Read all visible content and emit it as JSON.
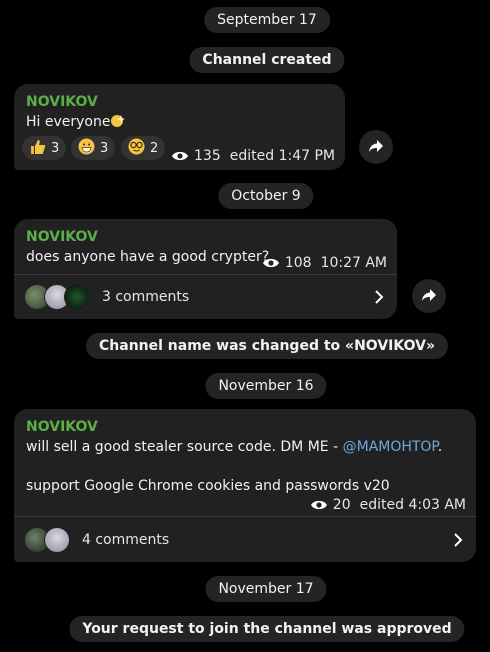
{
  "dates": [
    "September 17",
    "October 9",
    "November 16",
    "November 17"
  ],
  "service": {
    "created": "Channel created",
    "renamed": "Channel name was changed to «NOVIKOV»",
    "approved": "Your request to join the channel was approved"
  },
  "messages": [
    {
      "sender": "NOVIKOV",
      "text": "Hi everyone",
      "reactions": [
        {
          "icon": "thumbs-up-icon",
          "count": "3"
        },
        {
          "icon": "grinning-face-icon",
          "count": "3"
        },
        {
          "icon": "nerd-face-icon",
          "count": "2"
        }
      ],
      "views": "135",
      "time": "edited 1:47 PM"
    },
    {
      "sender": "NOVIKOV",
      "text": "does anyone have a good crypter?",
      "views": "108",
      "time": "10:27 AM",
      "comments": "3 comments"
    },
    {
      "sender": "NOVIKOV",
      "text_line1_prefix": "will sell a good stealer source code. DM ME - ",
      "mention": "@MAMOHTOP",
      "text_line1_suffix": ".",
      "text_line2": "support Google Chrome cookies and passwords v20",
      "views": "20",
      "time": "edited 4:03 AM",
      "comments": "4 comments"
    }
  ],
  "colors": {
    "sender": "#5cae49",
    "link": "#6fa8dc",
    "bubble": "#212121",
    "pill": "#242424"
  }
}
